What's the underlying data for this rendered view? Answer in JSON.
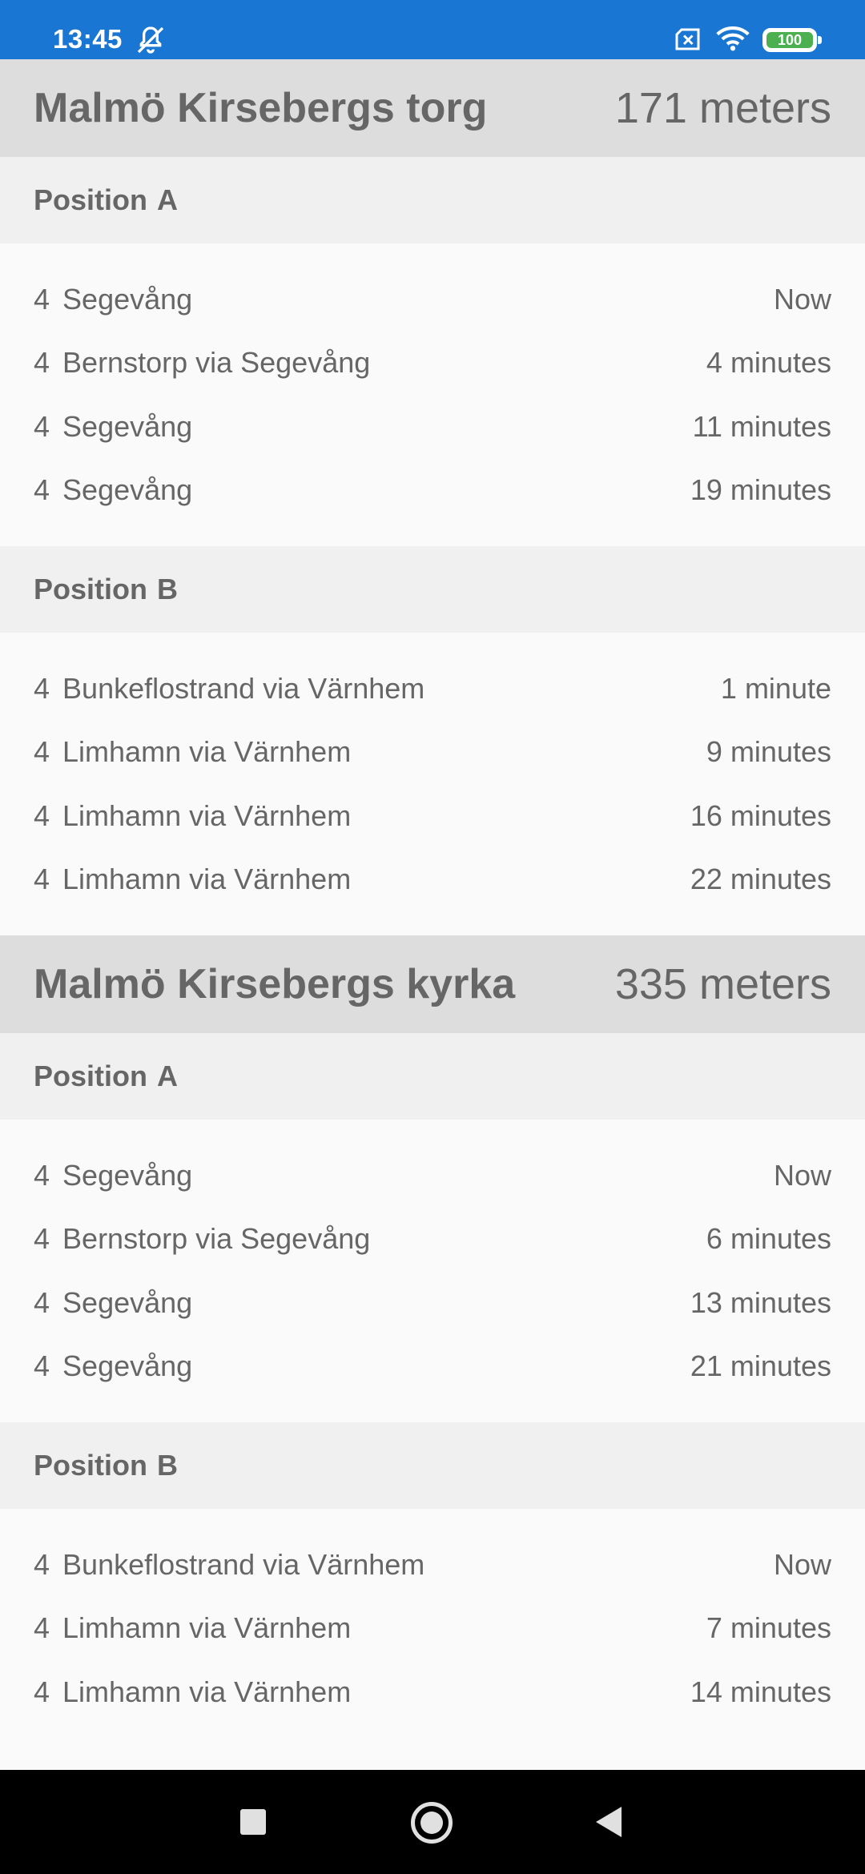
{
  "status_bar": {
    "time": "13:45",
    "battery": "100"
  },
  "stops": [
    {
      "name": "Malmö Kirsebergs torg",
      "distance": "171 meters",
      "positions": [
        {
          "label": "Position",
          "letter": "A",
          "departures": [
            {
              "line": "4",
              "destination": "Segevång",
              "time": "Now"
            },
            {
              "line": "4",
              "destination": "Bernstorp via Segevång",
              "time": "4 minutes"
            },
            {
              "line": "4",
              "destination": "Segevång",
              "time": "11 minutes"
            },
            {
              "line": "4",
              "destination": "Segevång",
              "time": "19 minutes"
            }
          ]
        },
        {
          "label": "Position",
          "letter": "B",
          "departures": [
            {
              "line": "4",
              "destination": "Bunkeflostrand via Värnhem",
              "time": "1 minute"
            },
            {
              "line": "4",
              "destination": "Limhamn via Värnhem",
              "time": "9 minutes"
            },
            {
              "line": "4",
              "destination": "Limhamn via Värnhem",
              "time": "16 minutes"
            },
            {
              "line": "4",
              "destination": "Limhamn via Värnhem",
              "time": "22 minutes"
            }
          ]
        }
      ]
    },
    {
      "name": "Malmö Kirsebergs kyrka",
      "distance": "335 meters",
      "positions": [
        {
          "label": "Position",
          "letter": "A",
          "departures": [
            {
              "line": "4",
              "destination": "Segevång",
              "time": "Now"
            },
            {
              "line": "4",
              "destination": "Bernstorp via Segevång",
              "time": "6 minutes"
            },
            {
              "line": "4",
              "destination": "Segevång",
              "time": "13 minutes"
            },
            {
              "line": "4",
              "destination": "Segevång",
              "time": "21 minutes"
            }
          ]
        },
        {
          "label": "Position",
          "letter": "B",
          "departures": [
            {
              "line": "4",
              "destination": "Bunkeflostrand via Värnhem",
              "time": "Now"
            },
            {
              "line": "4",
              "destination": "Limhamn via Värnhem",
              "time": "7 minutes"
            },
            {
              "line": "4",
              "destination": "Limhamn via Värnhem",
              "time": "14 minutes"
            }
          ]
        }
      ]
    }
  ]
}
